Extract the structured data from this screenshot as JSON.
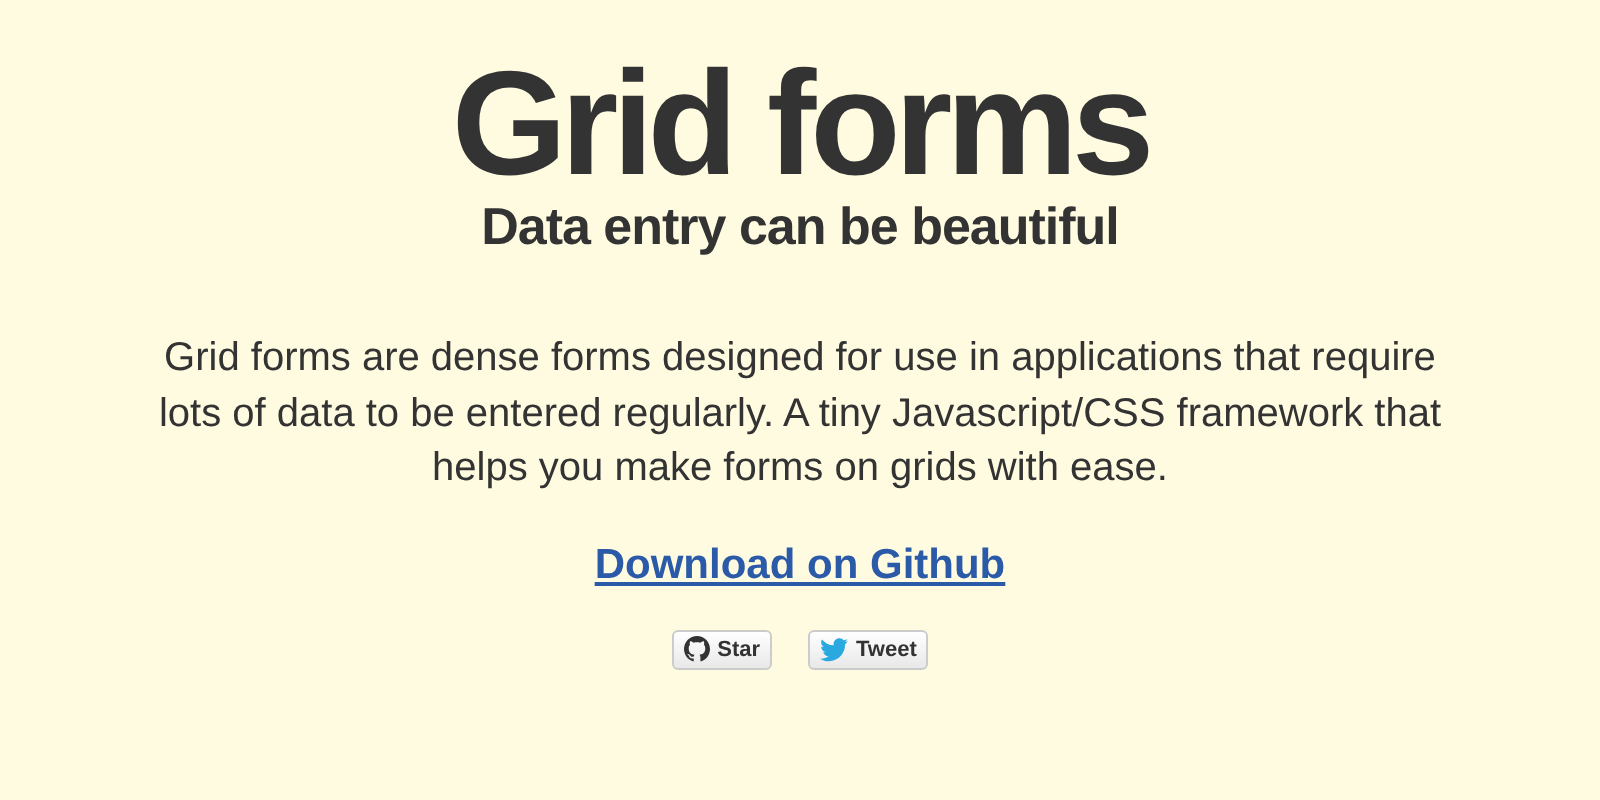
{
  "title": "Grid forms",
  "subtitle": "Data entry can be beautiful",
  "description": "Grid forms are dense forms designed for use in applications that require lots of data to be entered regularly. A tiny Javascript/CSS framework that helps you make forms on grids with ease.",
  "link": "Download on Github",
  "buttons": [
    {
      "kind": "github",
      "label": "Star"
    },
    {
      "kind": "twitter",
      "label": "Tweet"
    }
  ]
}
